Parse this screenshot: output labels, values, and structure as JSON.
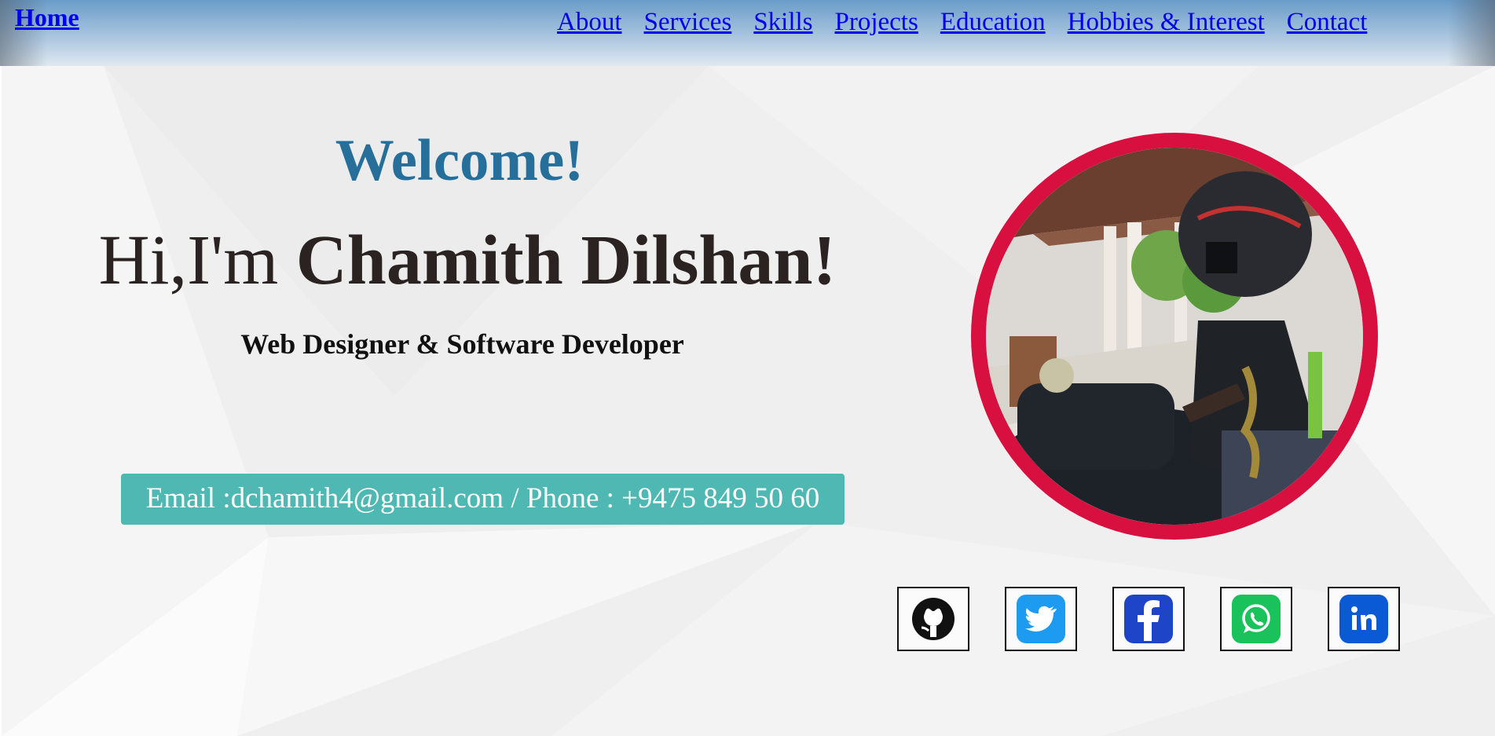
{
  "header": {
    "home_label": "Home",
    "nav": [
      "About",
      "Services",
      "Skills",
      "Projects",
      "Education",
      "Hobbies & Interest",
      "Contact"
    ]
  },
  "hero": {
    "welcome": "Welcome!",
    "greeting_prefix": "Hi,I'm",
    "name": "Chamith Dilshan!",
    "subtitle": "Web Designer & Software Developer",
    "contact": "Email :dchamith4@gmail.com / Phone : +9475 849 50 60"
  },
  "portrait": {
    "icon": "profile-photo"
  },
  "social": [
    {
      "name": "github",
      "icon": "github-icon",
      "color": "#111111"
    },
    {
      "name": "twitter",
      "icon": "twitter-icon",
      "color": "#1d9bf0"
    },
    {
      "name": "facebook",
      "icon": "facebook-icon",
      "color": "#1877f2"
    },
    {
      "name": "whatsapp",
      "icon": "whatsapp-icon",
      "color": "#25d366"
    },
    {
      "name": "linkedin",
      "icon": "linkedin-icon",
      "color": "#0a66c2"
    }
  ],
  "colors": {
    "welcome": "#256f9a",
    "contact_bg": "#4fb8b3",
    "portrait_ring": "#d7103f",
    "link": "#0000ee"
  }
}
